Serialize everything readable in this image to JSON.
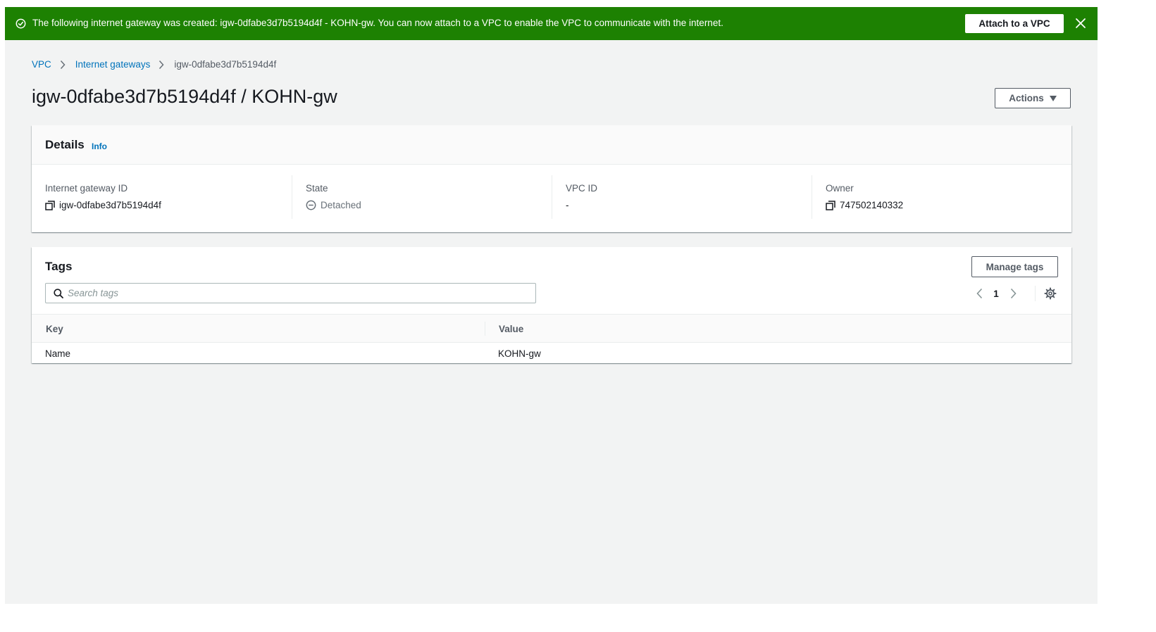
{
  "flash": {
    "message": "The following internet gateway was created: igw-0dfabe3d7b5194d4f - KOHN-gw. You can now attach to a VPC to enable the VPC to communicate with the internet.",
    "action_label": "Attach to a VPC",
    "color": "#1d8102",
    "icon": "success-circle-icon"
  },
  "breadcrumb": {
    "items": [
      "VPC",
      "Internet gateways",
      "igw-0dfabe3d7b5194d4f"
    ]
  },
  "page": {
    "title": "igw-0dfabe3d7b5194d4f / KOHN-gw",
    "actions_label": "Actions"
  },
  "details": {
    "title": "Details",
    "info_label": "Info",
    "fields": [
      {
        "label": "Internet gateway ID",
        "value": "igw-0dfabe3d7b5194d4f",
        "icon": "copy-icon"
      },
      {
        "label": "State",
        "value": "Detached",
        "icon": "detached-status-icon"
      },
      {
        "label": "VPC ID",
        "value": "-"
      },
      {
        "label": "Owner",
        "value": "747502140332",
        "icon": "copy-icon"
      }
    ]
  },
  "tags": {
    "title": "Tags",
    "manage_label": "Manage tags",
    "search_placeholder": "Search tags",
    "search_value": "",
    "current_page": "1",
    "columns": [
      "Key",
      "Value"
    ],
    "rows": [
      {
        "key": "Name",
        "value": "KOHN-gw"
      }
    ]
  },
  "colors": {
    "link": "#0073bb",
    "page_background": "#f2f3f3"
  }
}
